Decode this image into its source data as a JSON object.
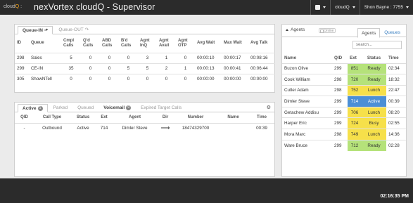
{
  "header": {
    "logo_prefix": "cloud",
    "logo_q": "Q",
    "logo_sep": ":",
    "title": "nexVortex cloudQ - Supervisor",
    "menu_cloudq": "cloudQ",
    "user": "Shon Bayne : 7755"
  },
  "queues_panel": {
    "tabs": [
      "Queue-IN",
      "Queue-OUT"
    ],
    "columns": [
      "ID",
      "Queue",
      "Cmpl Calls",
      "Q'd Calls",
      "ABD Calls",
      "B'd Calls",
      "Agnt InQ",
      "Agnt Avail",
      "Agnt OTP",
      "Avg Wait",
      "Max Wait",
      "Avg Talk"
    ],
    "rows": [
      [
        "298",
        "Sales",
        "5",
        "0",
        "0",
        "0",
        "3",
        "1",
        "0",
        "00:00:10",
        "00:00:17",
        "00:08:16"
      ],
      [
        "299",
        "CE-IN",
        "35",
        "0",
        "0",
        "5",
        "5",
        "2",
        "1",
        "00:00:13",
        "00:00:41",
        "00:06:44"
      ],
      [
        "305",
        "ShowNTell",
        "0",
        "0",
        "0",
        "0",
        "0",
        "0",
        "0",
        "00:00:00",
        "00:00:00",
        "00:00:00"
      ]
    ]
  },
  "calls_panel": {
    "tabs": [
      {
        "label": "Active",
        "badge": "1",
        "active": true
      },
      {
        "label": "Parked",
        "badge": "",
        "active": false
      },
      {
        "label": "Queued",
        "badge": "",
        "active": false
      },
      {
        "label": "Voicemail",
        "badge": "9",
        "active": false
      },
      {
        "label": "Expired Target Calls",
        "badge": "",
        "active": false
      }
    ],
    "columns": [
      "QID",
      "Call Type",
      "Status",
      "Ext",
      "Agent",
      "Dir",
      "Number",
      "Name",
      "Time"
    ],
    "rows": [
      [
        "-",
        "Outbound",
        "Active",
        "714",
        "Dimler Steve",
        "⟶",
        "18474329700",
        "",
        "00:39"
      ]
    ]
  },
  "agents_panel": {
    "toggle_label": "Agents",
    "online_label": "Online",
    "tabs": [
      "Agents",
      "Queues"
    ],
    "search_placeholder": "search...",
    "columns": [
      "Name",
      "QID",
      "Ext",
      "Status",
      "Time"
    ],
    "rows": [
      {
        "name": "Buzon Olive",
        "qid": "299",
        "ext": "851",
        "status": "Ready",
        "time": "02:34",
        "color": "#b5e27a"
      },
      {
        "name": "Cook William",
        "qid": "298",
        "ext": "720",
        "status": "Ready",
        "time": "18:32",
        "color": "#b5e27a"
      },
      {
        "name": "Cutler Adam",
        "qid": "298",
        "ext": "752",
        "status": "Lunch",
        "time": "22:47",
        "color": "#f6e04a"
      },
      {
        "name": "Dimler Steve",
        "qid": "299",
        "ext": "714",
        "status": "Active",
        "time": "00:39",
        "color": "#4b8fd6",
        "text": "#ffffff"
      },
      {
        "name": "Getachew Addisu",
        "qid": "299",
        "ext": "706",
        "status": "Lunch",
        "time": "08:20",
        "color": "#f6e04a"
      },
      {
        "name": "Harper Eric",
        "qid": "299",
        "ext": "724",
        "status": "Busy",
        "time": "02:55",
        "color": "#f6e04a"
      },
      {
        "name": "Mora Marc",
        "qid": "298",
        "ext": "749",
        "status": "Lunch",
        "time": "14:36",
        "color": "#f6e04a"
      },
      {
        "name": "Ware Bruce",
        "qid": "299",
        "ext": "712",
        "status": "Ready",
        "time": "02:28",
        "color": "#b5e27a"
      }
    ]
  },
  "footer": {
    "clock": "02:16:35 PM"
  }
}
